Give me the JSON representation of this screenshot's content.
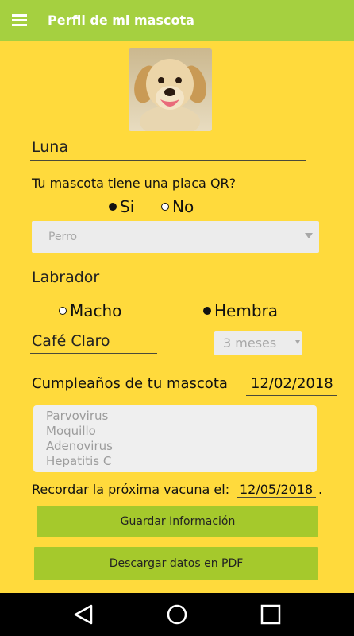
{
  "appbar": {
    "title": "Perfil de mi mascota",
    "menu_icon": "hamburger-menu-icon"
  },
  "pet": {
    "photo_icon": "dog-photo",
    "name": "Luna",
    "qr_question": "Tu mascota tiene una placa QR?",
    "qr_yes": "Si",
    "qr_no": "No",
    "qr_selected": "Si",
    "species": "Perro",
    "breed": "Labrador",
    "sex_male": "Macho",
    "sex_female": "Hembra",
    "sex_selected": "Hembra",
    "color": "Café Claro",
    "age": "3 meses",
    "birthday_label": "Cumpleaños de tu mascota",
    "birthday": "12/02/2018",
    "vaccines": [
      "Parvovirus",
      "Moquillo",
      "Adenovirus",
      "Hepatitis C"
    ],
    "next_vaccine_label": "Recordar la próxima vacuna el:",
    "next_vaccine_date": "12/05/2018",
    "next_vaccine_suffix": "."
  },
  "buttons": {
    "save": "Guardar Información",
    "pdf": "Descargar datos en PDF"
  },
  "navbar": {
    "icons": [
      "back-triangle-icon",
      "home-circle-icon",
      "recents-square-icon"
    ]
  },
  "colors": {
    "background": "#ffda3c",
    "appbar": "#a5d040",
    "button": "#a5c92c"
  }
}
